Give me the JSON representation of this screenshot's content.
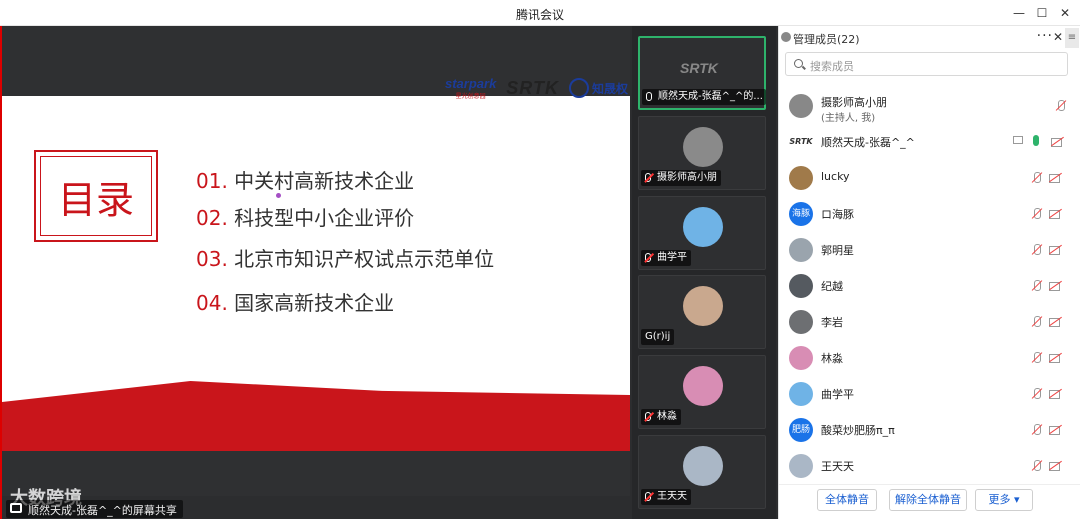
{
  "window": {
    "title": "腾讯会议",
    "minimize": "—",
    "maximize": "☐",
    "close": "✕"
  },
  "slide": {
    "logos": {
      "starpark": "starpark",
      "starpark_sub": "星光创意园",
      "srtk": "SRTK",
      "zhi": "知晟权"
    },
    "heading": "目录",
    "toc": [
      {
        "num": "01.",
        "text": "中关村高新技术企业"
      },
      {
        "num": "02.",
        "text": "科技型中小企业评价"
      },
      {
        "num": "03.",
        "text": "北京市知识产权试点示范单位"
      },
      {
        "num": "04.",
        "text": "国家高新技术企业"
      }
    ],
    "share_label": "顺然天成-张磊^_^的屏幕共享",
    "watermark": "大数跨境"
  },
  "video_tiles": [
    {
      "name": "顺然天成-张磊^_^的...",
      "kind": "logo",
      "logo_text": "SRTK",
      "active": true
    },
    {
      "name": "摄影师高小朋",
      "kind": "avatar",
      "color": "#8a8a8a"
    },
    {
      "name": "曲学平",
      "kind": "avatar",
      "color": "#6fb3e6"
    },
    {
      "name": "G(r)ij",
      "kind": "avatar",
      "color": "#c9a88e"
    },
    {
      "name": "林淼",
      "kind": "avatar",
      "color": "#d88db4"
    },
    {
      "name": "王天天",
      "kind": "avatar",
      "color": "#aab7c6"
    }
  ],
  "panel": {
    "title": "管理成员(22)",
    "more": "···",
    "close": "✕",
    "toggle": "≡",
    "search_placeholder": "搜索成员",
    "members": [
      {
        "name": "摄影师高小朋",
        "sub": "(主持人, 我)",
        "avatar_text": "",
        "color": "#888888"
      },
      {
        "name": "顺然天成-张磊^_^",
        "sub": "",
        "avatar_text": "SRTK",
        "color": "#ffffff"
      },
      {
        "name": "lucky",
        "sub": "",
        "avatar_text": "",
        "color": "#a07a4a"
      },
      {
        "name": "ロ海豚",
        "sub": "",
        "avatar_text": "海豚",
        "color": "#1a73e8"
      },
      {
        "name": "郭明星",
        "sub": "",
        "avatar_text": "",
        "color": "#9aa4ad"
      },
      {
        "name": "纪越",
        "sub": "",
        "avatar_text": "",
        "color": "#555a60"
      },
      {
        "name": "李岩",
        "sub": "",
        "avatar_text": "",
        "color": "#6d6f72"
      },
      {
        "name": "林淼",
        "sub": "",
        "avatar_text": "",
        "color": "#d88db4"
      },
      {
        "name": "曲学平",
        "sub": "",
        "avatar_text": "",
        "color": "#6fb3e6"
      },
      {
        "name": "酸菜炒肥肠π_π",
        "sub": "",
        "avatar_text": "肥肠",
        "color": "#1a73e8"
      },
      {
        "name": "王天天",
        "sub": "",
        "avatar_text": "",
        "color": "#aab7c6"
      }
    ],
    "buttons": {
      "mute_all": "全体静音",
      "unmute_all": "解除全体静音",
      "more": "更多 ▾"
    }
  }
}
